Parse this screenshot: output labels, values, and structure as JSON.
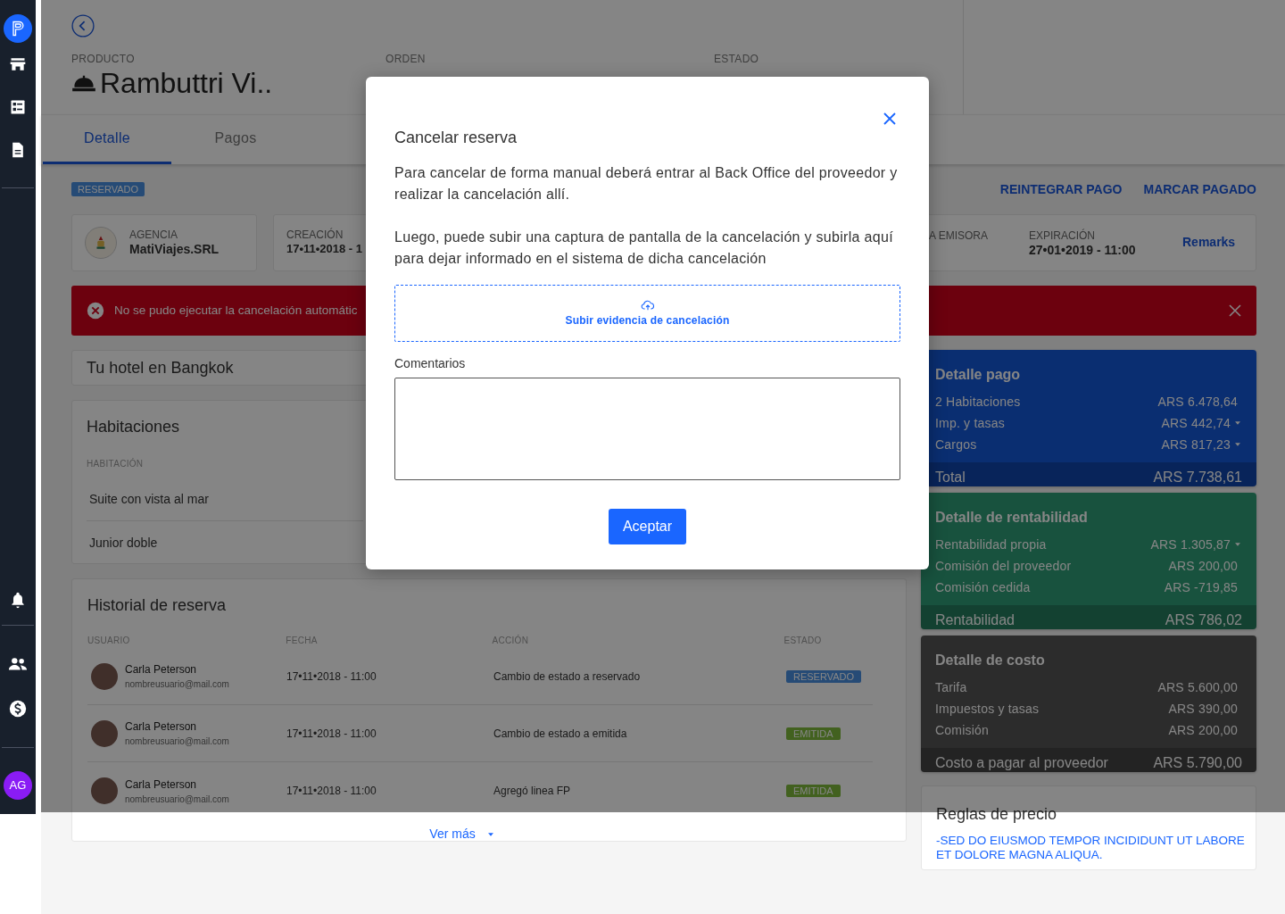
{
  "sidebar": {
    "avatar": "AG"
  },
  "header": {
    "product_label": "PRODUCTO",
    "product_name": "Rambuttri Vi..",
    "order_label": "ORDEN",
    "status_label": "ESTADO"
  },
  "tabs": [
    {
      "label": "Detalle",
      "selected": true
    },
    {
      "label": "Pagos",
      "selected": false
    }
  ],
  "status_badge": "RESERVADO",
  "actions": [
    "REINTEGRAR PAGO",
    "MARCAR PAGADO"
  ],
  "info": {
    "agency_label": "AGENCIA",
    "agency": "MatiViajes.SRL",
    "creation_label": "CREACIÓN",
    "creation": "17•11•2018 - 1",
    "issuer_label": "A EMISORA",
    "expiration_label": "EXPIRACIÓN",
    "expiration": "27•01•2019 - 11:00",
    "remarks": "Remarks"
  },
  "alert": {
    "message": "No se pudo ejecutar la cancelación automátic"
  },
  "hotel": {
    "title": "Tu hotel en Bangkok"
  },
  "rooms": {
    "title": "Habitaciones",
    "column": "HABITACIÓN",
    "rows": [
      "Suite con vista al mar",
      "Junior doble"
    ]
  },
  "history": {
    "title": "Historial de reserva",
    "columns": [
      "USUARIO",
      "FECHA",
      "ACCIÓN",
      "ESTADO"
    ],
    "rows": [
      {
        "user": "Carla Peterson",
        "email": "nombreusuario@mail.com",
        "date": "17•11•2018 - 11:00",
        "action": "Cambio de estado a reservado",
        "status": "RESERVADO",
        "kind": "reserved"
      },
      {
        "user": "Carla Peterson",
        "email": "nombreusuario@mail.com",
        "date": "17•11•2018 - 11:00",
        "action": "Cambio de estado a emitida",
        "status": "EMITIDA",
        "kind": "issued"
      },
      {
        "user": "Carla Peterson",
        "email": "nombreusuario@mail.com",
        "date": "17•11•2018 - 11:00",
        "action": "Agregó linea FP",
        "status": "EMITIDA",
        "kind": "issued"
      }
    ],
    "more": "Ver más"
  },
  "summaries": [
    {
      "title": "Detalle pago",
      "kind": "payment",
      "lines": [
        {
          "label": "2 Habitaciones",
          "amount": "ARS 6.478,64",
          "expandable": false
        },
        {
          "label": "Imp. y tasas",
          "amount": "ARS 442,74",
          "expandable": true
        },
        {
          "label": "Cargos",
          "amount": "ARS 817,23",
          "expandable": true
        }
      ],
      "total_label": "Total",
      "total": "ARS 7.738,61"
    },
    {
      "title": "Detalle de rentabilidad",
      "kind": "profit",
      "lines": [
        {
          "label": "Rentabilidad propia",
          "amount": "ARS 1.305,87",
          "expandable": true
        },
        {
          "label": "Comisión del proveedor",
          "amount": "ARS 200,00",
          "expandable": false
        },
        {
          "label": "Comisión cedida",
          "amount": "ARS -719,85",
          "expandable": false
        }
      ],
      "total_label": "Rentabilidad",
      "total": "ARS 786,02"
    },
    {
      "title": "Detalle de costo",
      "kind": "cost",
      "lines": [
        {
          "label": "Tarifa",
          "amount": "ARS 5.600,00",
          "expandable": false
        },
        {
          "label": "Impuestos y tasas",
          "amount": "ARS 390,00",
          "expandable": false
        },
        {
          "label": "Comisión",
          "amount": "ARS 200,00",
          "expandable": false
        }
      ],
      "total_label": "Costo a pagar al proveedor",
      "total": "ARS 5.790,00"
    }
  ],
  "price_rules": {
    "title": "Reglas de precio",
    "text": "-SED DO EIUSMOD TEMPOR INCIDIDUNT UT LABORE ET DOLORE MAGNA ALIQUA."
  },
  "modal": {
    "title": "Cancelar reserva",
    "paragraphs": [
      "Para cancelar de forma manual deberá entrar al Back Office del proveedor y realizar la cancelación allí.",
      "Luego, puede subir una captura de pantalla de la cancelación y subirla aquí para dejar informado en el sistema de dicha cancelación"
    ],
    "upload": "Subir evidencia de cancelación",
    "comments_label": "Comentarios",
    "submit": "Aceptar"
  }
}
